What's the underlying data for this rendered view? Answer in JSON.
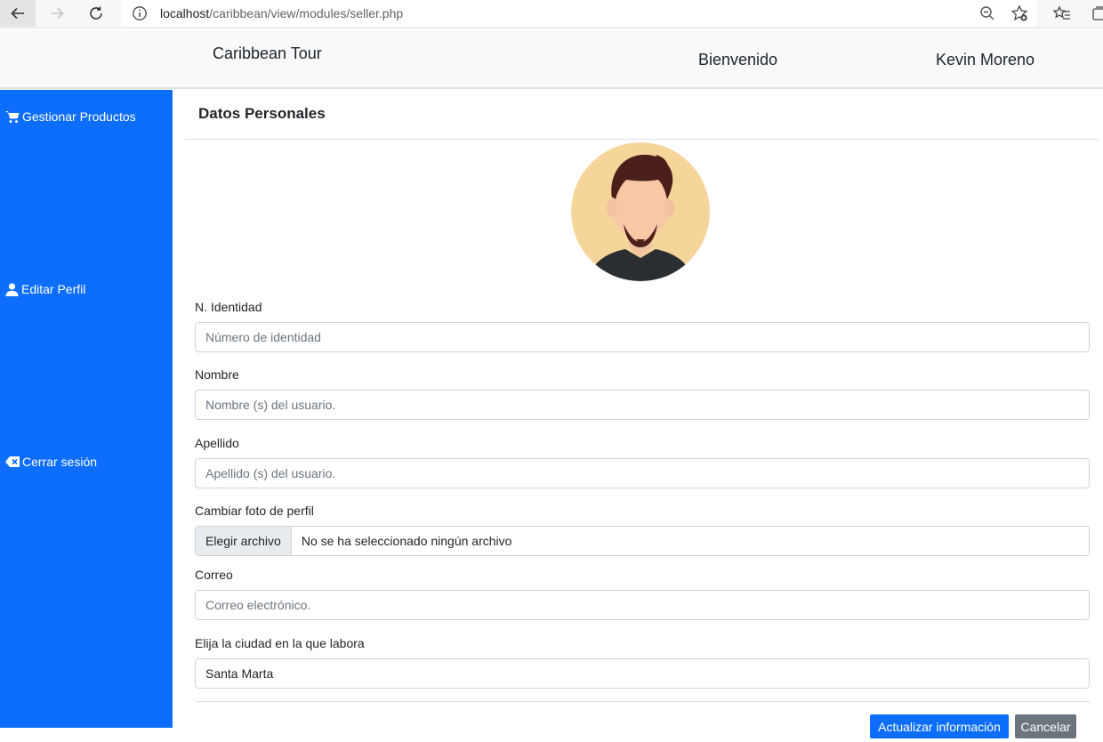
{
  "browser": {
    "url_host": "localhost",
    "url_path": "/caribbean/view/modules/seller.php"
  },
  "header": {
    "brand": "Caribbean Tour",
    "welcome": "Bienvenido",
    "username": "Kevin Moreno"
  },
  "sidebar": {
    "items": [
      {
        "label": "Gestionar Productos",
        "icon": "cart-icon"
      },
      {
        "label": "Editar Perfil",
        "icon": "user-icon"
      },
      {
        "label": "Cerrar sesión",
        "icon": "logout-icon"
      }
    ]
  },
  "main": {
    "title": "Datos Personales",
    "fields": {
      "identidad": {
        "label": "N. Identidad",
        "placeholder": "Número de identidad",
        "value": ""
      },
      "nombre": {
        "label": "Nombre",
        "placeholder": "Nombre (s) del usuario.",
        "value": ""
      },
      "apellido": {
        "label": "Apellido",
        "placeholder": "Apellido (s) del usuario.",
        "value": ""
      },
      "foto": {
        "label": "Cambiar foto de perfil",
        "button": "Elegir archivo",
        "status": "No se ha seleccionado ningún archivo"
      },
      "correo": {
        "label": "Correo",
        "placeholder": "Correo electrónico.",
        "value": ""
      },
      "ciudad": {
        "label": "Elija la ciudad en la que labora",
        "selected": "Santa Marta"
      }
    },
    "buttons": {
      "update": "Actualizar información",
      "cancel": "Cancelar"
    }
  },
  "colors": {
    "primary": "#0d6efd",
    "secondary": "#6c757d",
    "header_bg": "#f8f9fa"
  }
}
